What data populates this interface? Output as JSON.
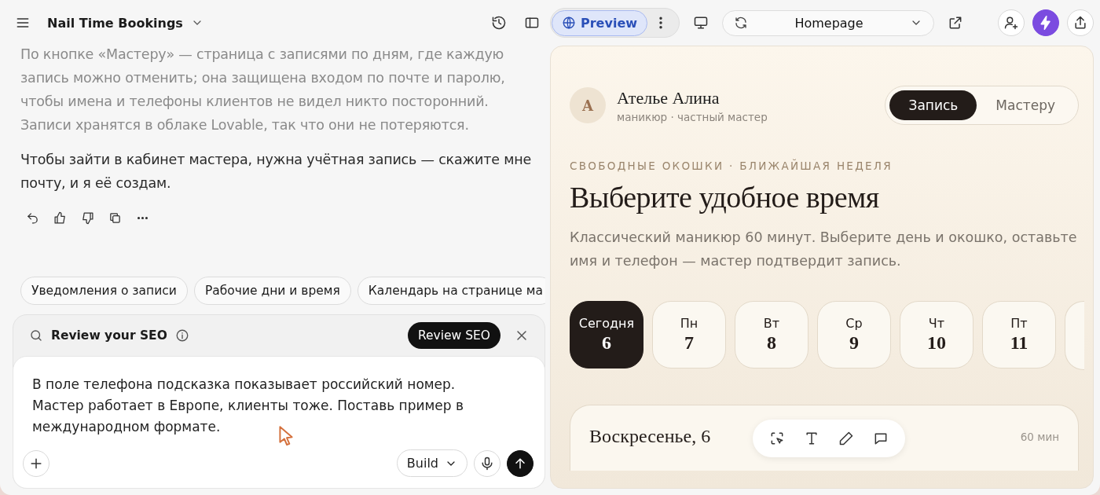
{
  "header": {
    "project_title": "Nail Time Bookings"
  },
  "chat": {
    "paragraphs": [
      "По кнопке «Мастеру» — страница с записями по дням, где каждую запись можно отменить; она защищена входом по почте и паролю, чтобы имена и телефоны клиентов не видел никто посторонний. Записи хранятся в облаке Lovable, так что они не потеряются.",
      "Чтобы зайти в кабинет мастера, нужна учётная запись — скажите мне почту, и я её создам."
    ],
    "suggestions": [
      "Уведомления о записи",
      "Рабочие дни и время",
      "Календарь на странице ма"
    ],
    "seo_bar": {
      "title": "Review your SEO",
      "button": "Review SEO"
    },
    "composer": {
      "value": "В поле телефона подсказка показывает российский номер. Мастер работает в Европе, клиенты тоже. Поставь пример в международном формате.",
      "mode": "Build"
    }
  },
  "preview_bar": {
    "tab": {
      "label": "Preview",
      "selected": true
    },
    "page": "Homepage"
  },
  "site": {
    "avatar_letter": "А",
    "name": "Ателье Алина",
    "subtitle": "маникюр · частный мастер",
    "nav": [
      {
        "label": "Запись",
        "selected": true
      },
      {
        "label": "Мастеру",
        "selected": false
      }
    ],
    "eyebrow": "СВОБОДНЫЕ ОКОШКИ · БЛИЖАЙШАЯ НЕДЕЛЯ",
    "heading": "Выберите удобное время",
    "description": "Классический маникюр 60 минут. Выберите день и окошко, оставьте имя и телефон — мастер подтвердит запись.",
    "days": [
      {
        "label": "Сегодня",
        "number": "6",
        "selected": true
      },
      {
        "label": "Пн",
        "number": "7",
        "selected": false
      },
      {
        "label": "Вт",
        "number": "8",
        "selected": false
      },
      {
        "label": "Ср",
        "number": "9",
        "selected": false
      },
      {
        "label": "Чт",
        "number": "10",
        "selected": false
      },
      {
        "label": "Пт",
        "number": "11",
        "selected": false
      }
    ],
    "day_panel": {
      "title": "Воскресенье, 6",
      "duration": "60 мин"
    }
  }
}
